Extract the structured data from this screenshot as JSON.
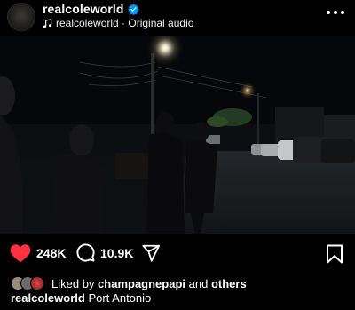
{
  "post": {
    "username": "realcoleworld",
    "audio_label": "realcoleworld · Original audio",
    "more_icon": "more-horizontal-icon"
  },
  "actions": {
    "like_count": "248K",
    "comment_count": "10.9K",
    "icons": [
      "heart-icon",
      "comment-icon",
      "share-icon",
      "bookmark-icon"
    ],
    "like_color": "#ff3040"
  },
  "likes": {
    "prefix": "Liked by",
    "liker": "champagnepapi",
    "conjunction": "and",
    "others": "others"
  },
  "caption": {
    "username": "realcoleworld",
    "text": "Port Antonio"
  }
}
